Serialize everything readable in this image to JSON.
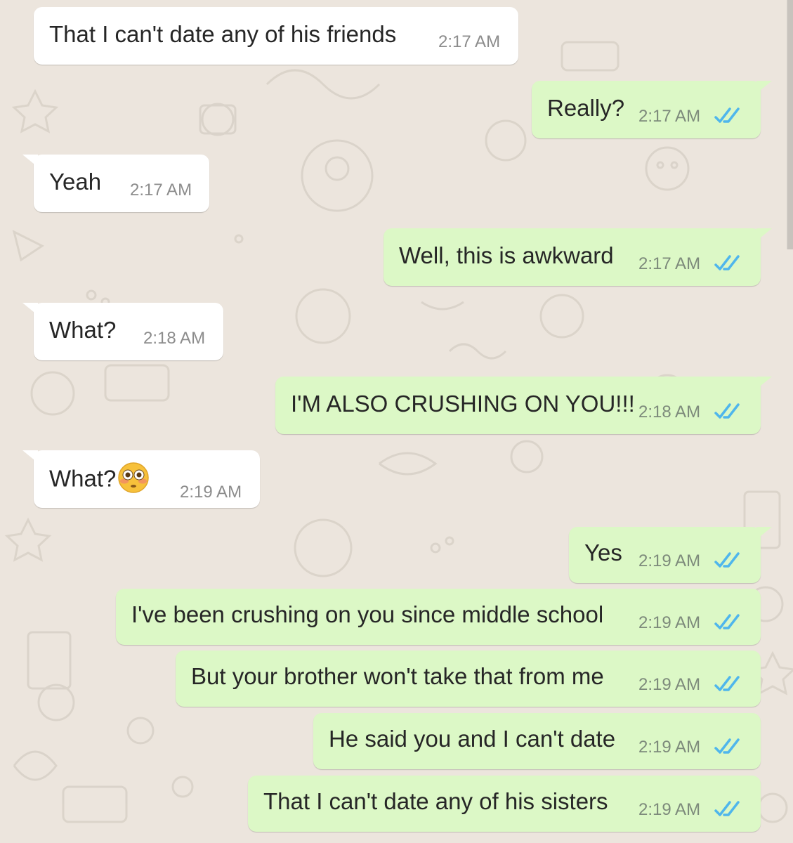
{
  "chat": {
    "messages": [
      {
        "direction": "in",
        "text": "That I can't date any of his friends",
        "time": "2:17 AM"
      },
      {
        "direction": "out",
        "text": "Really?",
        "time": "2:17 AM",
        "status": "read"
      },
      {
        "direction": "in",
        "text": "Yeah",
        "time": "2:17 AM"
      },
      {
        "direction": "out",
        "text": "Well, this is awkward",
        "time": "2:17 AM",
        "status": "read"
      },
      {
        "direction": "in",
        "text": "What?",
        "time": "2:18 AM"
      },
      {
        "direction": "out",
        "text": "I'M ALSO CRUSHING ON YOU!!!",
        "time": "2:18 AM",
        "status": "read"
      },
      {
        "direction": "in",
        "text": "What?",
        "emoji": "flushed-face",
        "time": "2:19 AM"
      },
      {
        "direction": "out",
        "text": "Yes",
        "time": "2:19 AM",
        "status": "read"
      },
      {
        "direction": "out",
        "text": "I've been crushing on you since middle school",
        "time": "2:19 AM",
        "status": "read"
      },
      {
        "direction": "out",
        "text": "But your brother won't take that from me",
        "time": "2:19 AM",
        "status": "read"
      },
      {
        "direction": "out",
        "text": "He said you and I can't date",
        "time": "2:19 AM",
        "status": "read"
      },
      {
        "direction": "out",
        "text": "That I can't date any of his sisters",
        "time": "2:19 AM",
        "status": "read"
      }
    ]
  },
  "colors": {
    "background": "#ece5dd",
    "incoming_bubble": "#ffffff",
    "outgoing_bubble": "#dcf8c6",
    "read_tick": "#4fb6ec",
    "doodle": "#d9d2c8"
  },
  "icons": {
    "read_receipt": "double-check-icon",
    "background": "doodle-pattern"
  }
}
